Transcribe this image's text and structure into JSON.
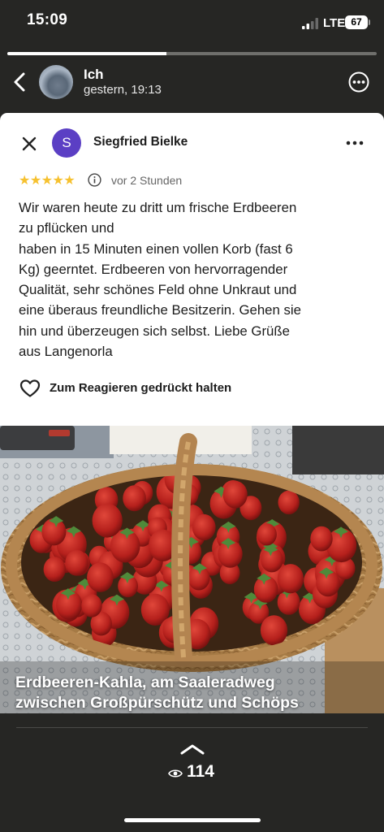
{
  "status_bar": {
    "time": "15:09",
    "network": "LTE",
    "battery": "67"
  },
  "story": {
    "progress_fraction": 0.43,
    "name": "Ich",
    "time": "gestern, 19:13",
    "views": "114"
  },
  "review": {
    "author_initial": "S",
    "author_name": "Siegfried Bielke",
    "rating_stars": "★★★★★",
    "rating": 5,
    "time": "vor 2 Stunden",
    "text": "Wir waren heute zu dritt um frische Erdbeeren\nzu pflücken und\nhaben in 15 Minuten einen vollen Korb (fast 6\nKg) geerntet. Erdbeeren von hervorragender\nQualität, sehr schönes Feld ohne Unkraut und\neine überaus freundliche Besitzerin. Gehen sie\nhin und überzeugen sich selbst. Liebe Grüße\naus Langenorla",
    "react_label": "Zum Reagieren gedrückt halten"
  },
  "photo": {
    "caption": "Erdbeeren-Kahla, am Saaleradweg\nzwischen Großpürschütz und Schöps"
  },
  "colors": {
    "background": "#262624",
    "card": "#ffffff",
    "star": "#f6c12f",
    "author_avatar": "#5b3fc4"
  },
  "icons": [
    "back-chevron-icon",
    "more-icon",
    "close-icon",
    "info-icon",
    "heart-icon",
    "chevron-up-icon",
    "eye-icon"
  ]
}
